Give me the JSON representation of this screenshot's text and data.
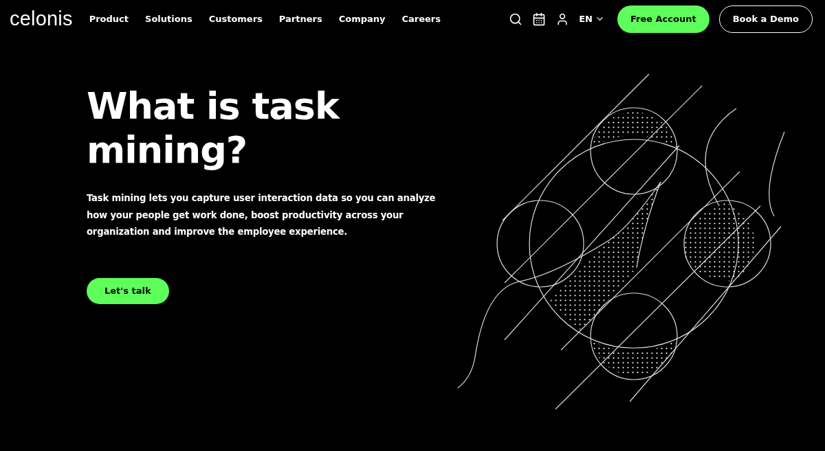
{
  "header": {
    "logo": "celonis",
    "nav": [
      "Product",
      "Solutions",
      "Customers",
      "Partners",
      "Company",
      "Careers"
    ],
    "language": "EN",
    "buttons": [
      {
        "label": "Free Account",
        "kind": "primary"
      },
      {
        "label": "Book a Demo",
        "kind": "outline"
      }
    ]
  },
  "hero": {
    "title": "What is task mining?",
    "description": "Task mining lets you capture user interaction data so you can analyze how your people get work done, boost productivity across your organization and improve the employee experience.",
    "cta": "Let's talk"
  }
}
